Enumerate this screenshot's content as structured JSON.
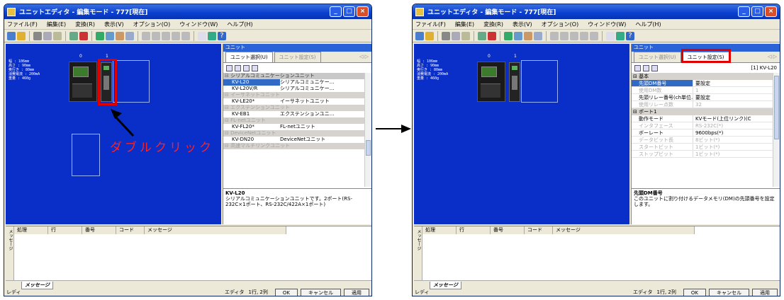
{
  "window": {
    "title": "ユニットエディタ - 編集モード - 777[現在]",
    "controls": {
      "minimize": "_",
      "maximize": "□",
      "close": "×"
    }
  },
  "menu": [
    "ファイル(F)",
    "編集(E)",
    "変換(R)",
    "表示(V)",
    "オプション(O)",
    "ウィンドウ(W)",
    "ヘルプ(H)"
  ],
  "specs": "幅 : 106mm\n高さ : 90mm\n奥行き : 80mm\n消費電流 : 200mA\n重量 : 460g",
  "slots": [
    "0",
    "1"
  ],
  "annotation": {
    "double_click": "ダブルクリック"
  },
  "panel": {
    "title": "ユニット",
    "tab_select": "ユニット選択(U)",
    "tab_settings": "ユニット設定(S)",
    "tab_scroll": "◁ ▷"
  },
  "unit_list": [
    {
      "category": "シリアルコミュニケーションユニット",
      "items": [
        {
          "model": "KV-L20",
          "name": "シリアルコミュニケー..."
        },
        {
          "model": "KV-L20V/R",
          "name": "シリアルコミュニケー..."
        }
      ]
    },
    {
      "category": "イーサネットユニット",
      "items": [
        {
          "model": "KV-LE20*",
          "name": "イーサネットユニット"
        }
      ]
    },
    {
      "category": "エクステンションユニット",
      "items": [
        {
          "model": "KV-EB1",
          "name": "エクステンションユニ..."
        }
      ]
    },
    {
      "category": "FL-netユニット",
      "items": [
        {
          "model": "KV-FL20*",
          "name": "FL-netユニット"
        }
      ]
    },
    {
      "category": "DeviceNetユニット",
      "items": [
        {
          "model": "KV-DN20",
          "name": "DeviceNetユニット"
        }
      ]
    },
    {
      "category": "高速マルチリンクユニット",
      "items": []
    }
  ],
  "left_desc": {
    "title": "KV-L20",
    "text": "シリアルコミュニケーションユニットです。2ポート(RS-232C×1ポート、RS-232C/422A×1ポート)"
  },
  "settings": {
    "unit_label": "[1] KV-L20",
    "category1": "基本",
    "category2": "ポート1",
    "rows": [
      {
        "key": "先頭DM番号",
        "value": "要設定"
      },
      {
        "key": "使用DM数",
        "value": "1"
      },
      {
        "key": "先頭リレー番号(ch単位...",
        "value": "要設定"
      },
      {
        "key": "使用リレー点数",
        "value": "32"
      },
      {
        "key": "動作モード",
        "value": "KVモード(上位リンク)(C"
      },
      {
        "key": "インタフェース",
        "value": "RS-232C(*)"
      },
      {
        "key": "ボーレート",
        "value": "9600bps(*)"
      },
      {
        "key": "データビット長",
        "value": "8ビット(*)"
      },
      {
        "key": "スタートビット",
        "value": "1ビット(*)"
      },
      {
        "key": "ストップビット",
        "value": "1ビット(*)"
      }
    ]
  },
  "right_desc": {
    "title": "先頭DM番号",
    "text": "このユニットに割り付けるデータメモリ(DM)の先頭番号を設定します。"
  },
  "messages": {
    "side_label": "メッセージ",
    "headers": [
      "処理",
      "行",
      "番号",
      "コード",
      "メッセージ"
    ],
    "tab": "メッセージ"
  },
  "status": {
    "ready": "レディ",
    "editor": "エディタ",
    "position": "1行, 2列",
    "ok": "OK",
    "cancel": "キャンセル",
    "apply": "適用"
  },
  "colors": {
    "canvas": "#0a2ec8",
    "highlight": "#e00000",
    "selection": "#316ac5"
  }
}
